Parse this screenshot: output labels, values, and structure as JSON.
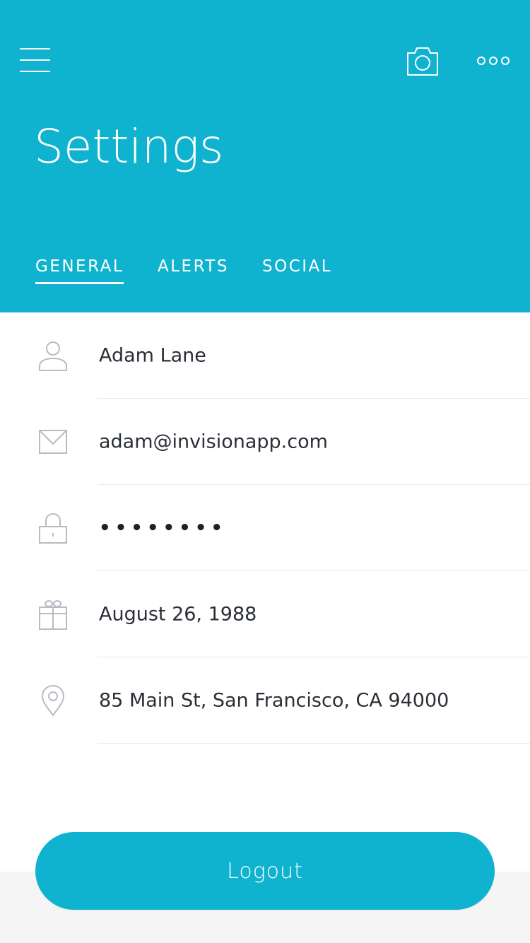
{
  "header": {
    "title": "Settings",
    "background_color": "#10B3CF",
    "icons": {
      "menu": "hamburger-menu-icon",
      "camera": "camera-icon",
      "more": "more-options-icon"
    }
  },
  "tabs": [
    {
      "label": "GENERAL",
      "active": true
    },
    {
      "label": "ALERTS",
      "active": false
    },
    {
      "label": "SOCIAL",
      "active": false
    }
  ],
  "fields": [
    {
      "icon": "user-icon",
      "value": "Adam Lane"
    },
    {
      "icon": "mail-icon",
      "value": "adam@invisionapp.com"
    },
    {
      "icon": "lock-icon",
      "value": "••••••••"
    },
    {
      "icon": "gift-icon",
      "value": "August 26, 1988"
    },
    {
      "icon": "location-pin-icon",
      "value": "85 Main St, San Francisco, CA 94000"
    }
  ],
  "logout": {
    "label": "Logout",
    "color": "#10B3CF"
  }
}
